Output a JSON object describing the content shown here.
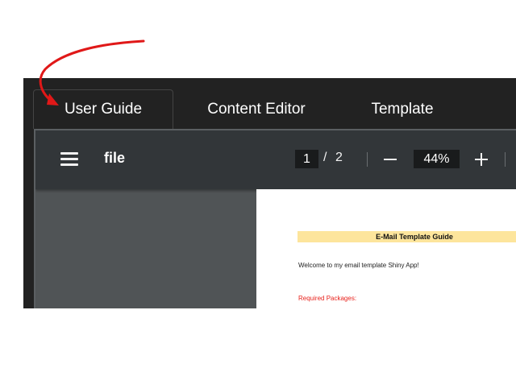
{
  "tabs": [
    {
      "label": "User Guide",
      "active": true
    },
    {
      "label": "Content Editor",
      "active": false
    },
    {
      "label": "Template",
      "active": false
    }
  ],
  "toolbar": {
    "file_label": "file",
    "current_page": "1",
    "page_separator": "/",
    "total_pages": "2",
    "zoom": "44%"
  },
  "document": {
    "heading": "E-Mail Template Guide",
    "welcome": "Welcome to my email template Shiny App!",
    "required": "Required Packages:"
  },
  "colors": {
    "annotation_arrow": "#e01818",
    "heading_highlight": "#fde59c",
    "required_text": "#e8221c"
  }
}
